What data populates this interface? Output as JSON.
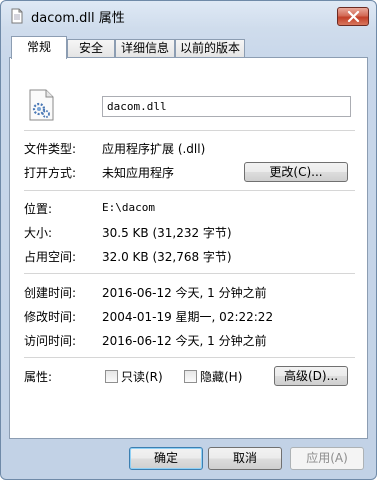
{
  "window": {
    "title": "dacom.dll 属性"
  },
  "tabs": [
    "常规",
    "安全",
    "详细信息",
    "以前的版本"
  ],
  "general": {
    "filename": "dacom.dll",
    "file_type_label": "文件类型:",
    "file_type_value": "应用程序扩展 (.dll)",
    "opens_with_label": "打开方式:",
    "opens_with_value": "未知应用程序",
    "change_button": "更改(C)...",
    "location_label": "位置:",
    "location_value": "E:\\dacom",
    "size_label": "大小:",
    "size_value": "30.5 KB (31,232 字节)",
    "size_on_disk_label": "占用空间:",
    "size_on_disk_value": "32.0 KB (32,768 字节)",
    "created_label": "创建时间:",
    "created_value": "2016-06-12 今天, 1 分钟之前",
    "modified_label": "修改时间:",
    "modified_value": "2004-01-19 星期一, 02:22:22",
    "accessed_label": "访问时间:",
    "accessed_value": "2016-06-12 今天, 1 分钟之前",
    "attributes_label": "属性:",
    "readonly_label": "只读(R)",
    "hidden_label": "隐藏(H)",
    "advanced_button": "高级(D)..."
  },
  "footer": {
    "ok": "确定",
    "cancel": "取消",
    "apply": "应用(A)"
  }
}
